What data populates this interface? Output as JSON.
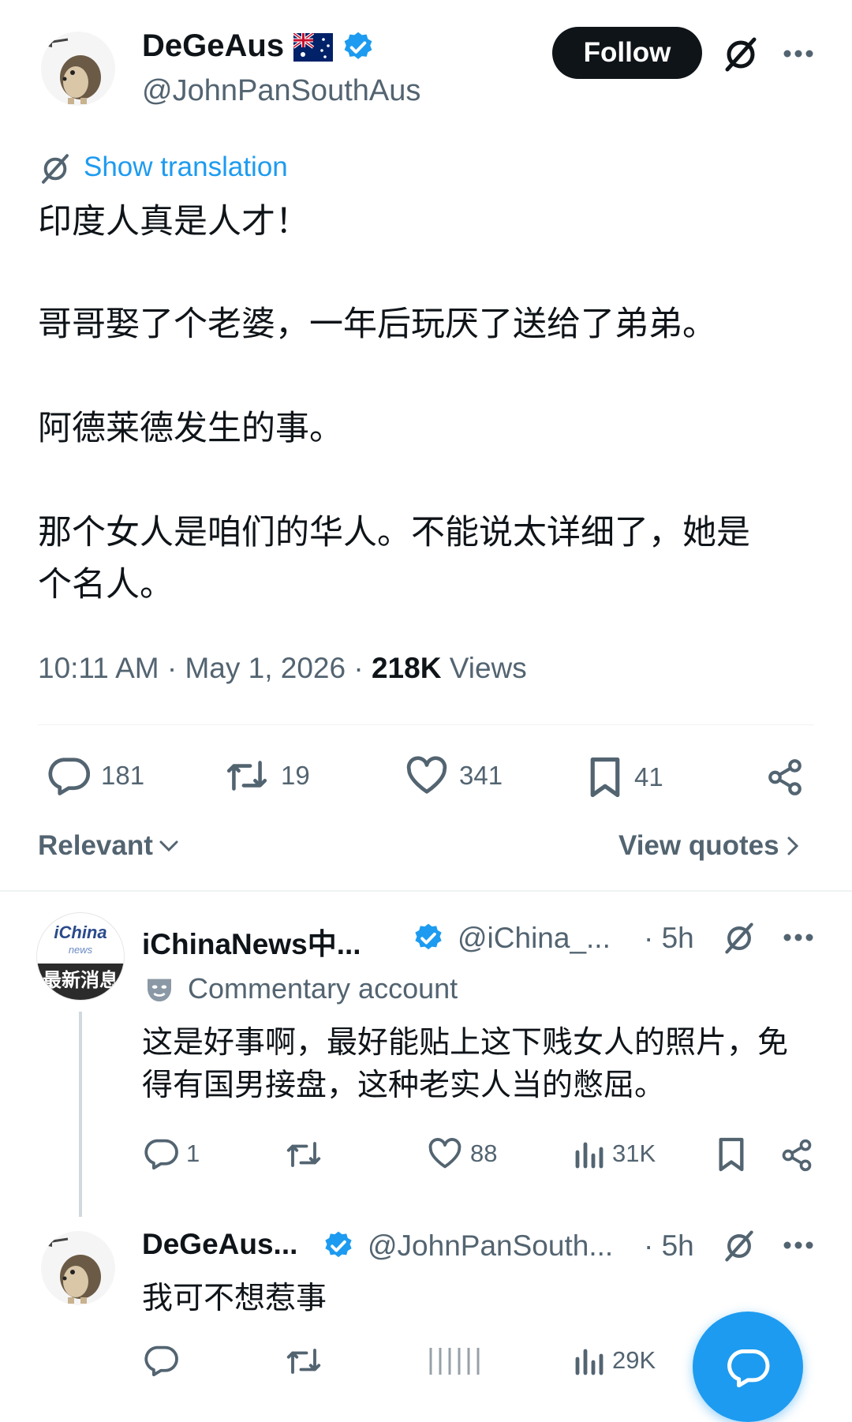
{
  "main_tweet": {
    "display_name": "DeGeAus",
    "handle": "@JohnPanSouthAus",
    "follow_label": "Follow",
    "show_translation": "Show translation",
    "lines": [
      "印度人真是人才！",
      "哥哥娶了个老婆，一年后玩厌了送给了弟弟。",
      "阿德莱德发生的事。",
      "那个女人是咱们的华人。不能说太详细了，她是",
      "个名人。"
    ],
    "timestamp": "10:11 AM · May 1, 2026 · ",
    "views_count": "218K",
    "views_label": " Views",
    "stats": {
      "replies": "181",
      "retweets": "19",
      "likes": "341",
      "bookmarks": "41"
    }
  },
  "sort": {
    "relevant_label": "Relevant",
    "view_quotes_label": "View quotes"
  },
  "reply1": {
    "avatar_text_top": "iChina",
    "avatar_text_small": "news",
    "avatar_text_bottom": "最新消息",
    "display_name": "iChinaNews中...",
    "handle": "@iChina_...",
    "time": "· 5h",
    "label": "Commentary account",
    "lines": [
      "这是好事啊，最好能贴上这下贱女人的照片，免",
      "得有国男接盘，这种老实人当的憋屈。"
    ],
    "stats": {
      "replies": "1",
      "retweets": "",
      "likes": "88",
      "views": "31K"
    }
  },
  "reply2": {
    "display_name": "DeGeAus...",
    "handle": "@JohnPanSouth...",
    "time": "· 5h",
    "text": "我可不想惹事",
    "stats": {
      "views": "29K"
    }
  },
  "colors": {
    "accent": "#1d9bf0",
    "text": "#0f1419",
    "secondary": "#536471",
    "follow_bg": "#0f1419",
    "translation": "#1d9bf0"
  }
}
